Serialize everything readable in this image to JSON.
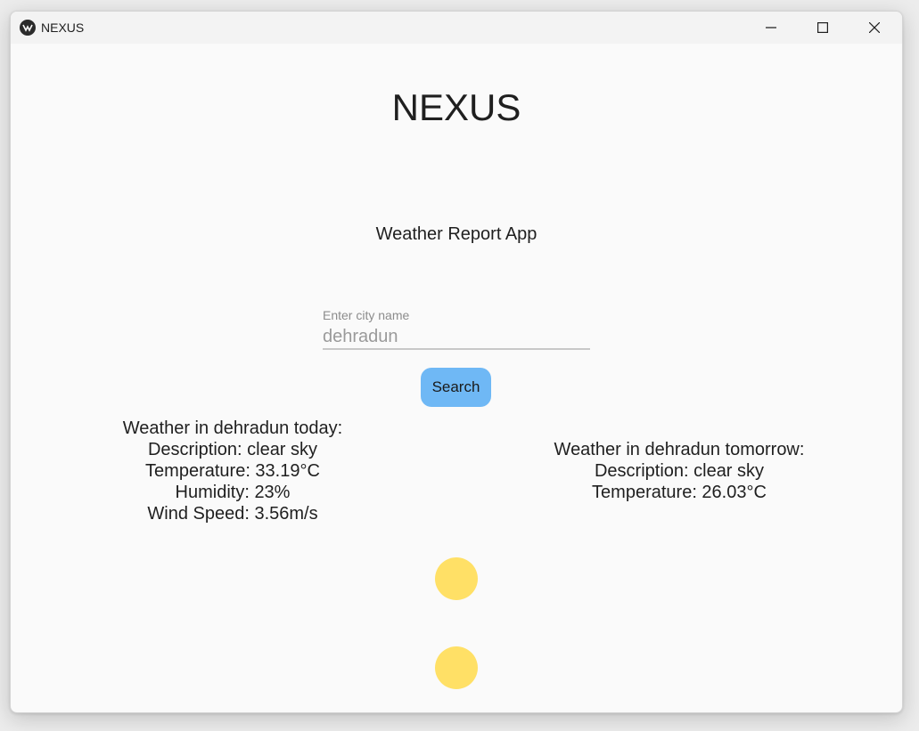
{
  "window": {
    "title": "NEXUS",
    "controls": [
      "minimize-icon",
      "maximize-icon",
      "close-icon"
    ]
  },
  "app": {
    "title": "NEXUS",
    "subtitle": "Weather Report App"
  },
  "search": {
    "label": "Enter city name",
    "value": "dehradun",
    "button_label": "Search"
  },
  "today": {
    "heading": "Weather in dehradun today:",
    "description": "Description: clear sky",
    "temperature": "Temperature: 33.19°C",
    "humidity": "Humidity: 23%",
    "wind": "Wind Speed: 3.56m/s"
  },
  "tomorrow": {
    "heading": "Weather in dehradun tomorrow:",
    "description": "Description: clear sky",
    "temperature": "Temperature: 26.03°C"
  },
  "icons": {
    "weather_icons": [
      "sun-icon",
      "sun-icon"
    ],
    "color": "#ffe066"
  },
  "colors": {
    "button": "#6fb8f5",
    "background": "#fafafa"
  }
}
